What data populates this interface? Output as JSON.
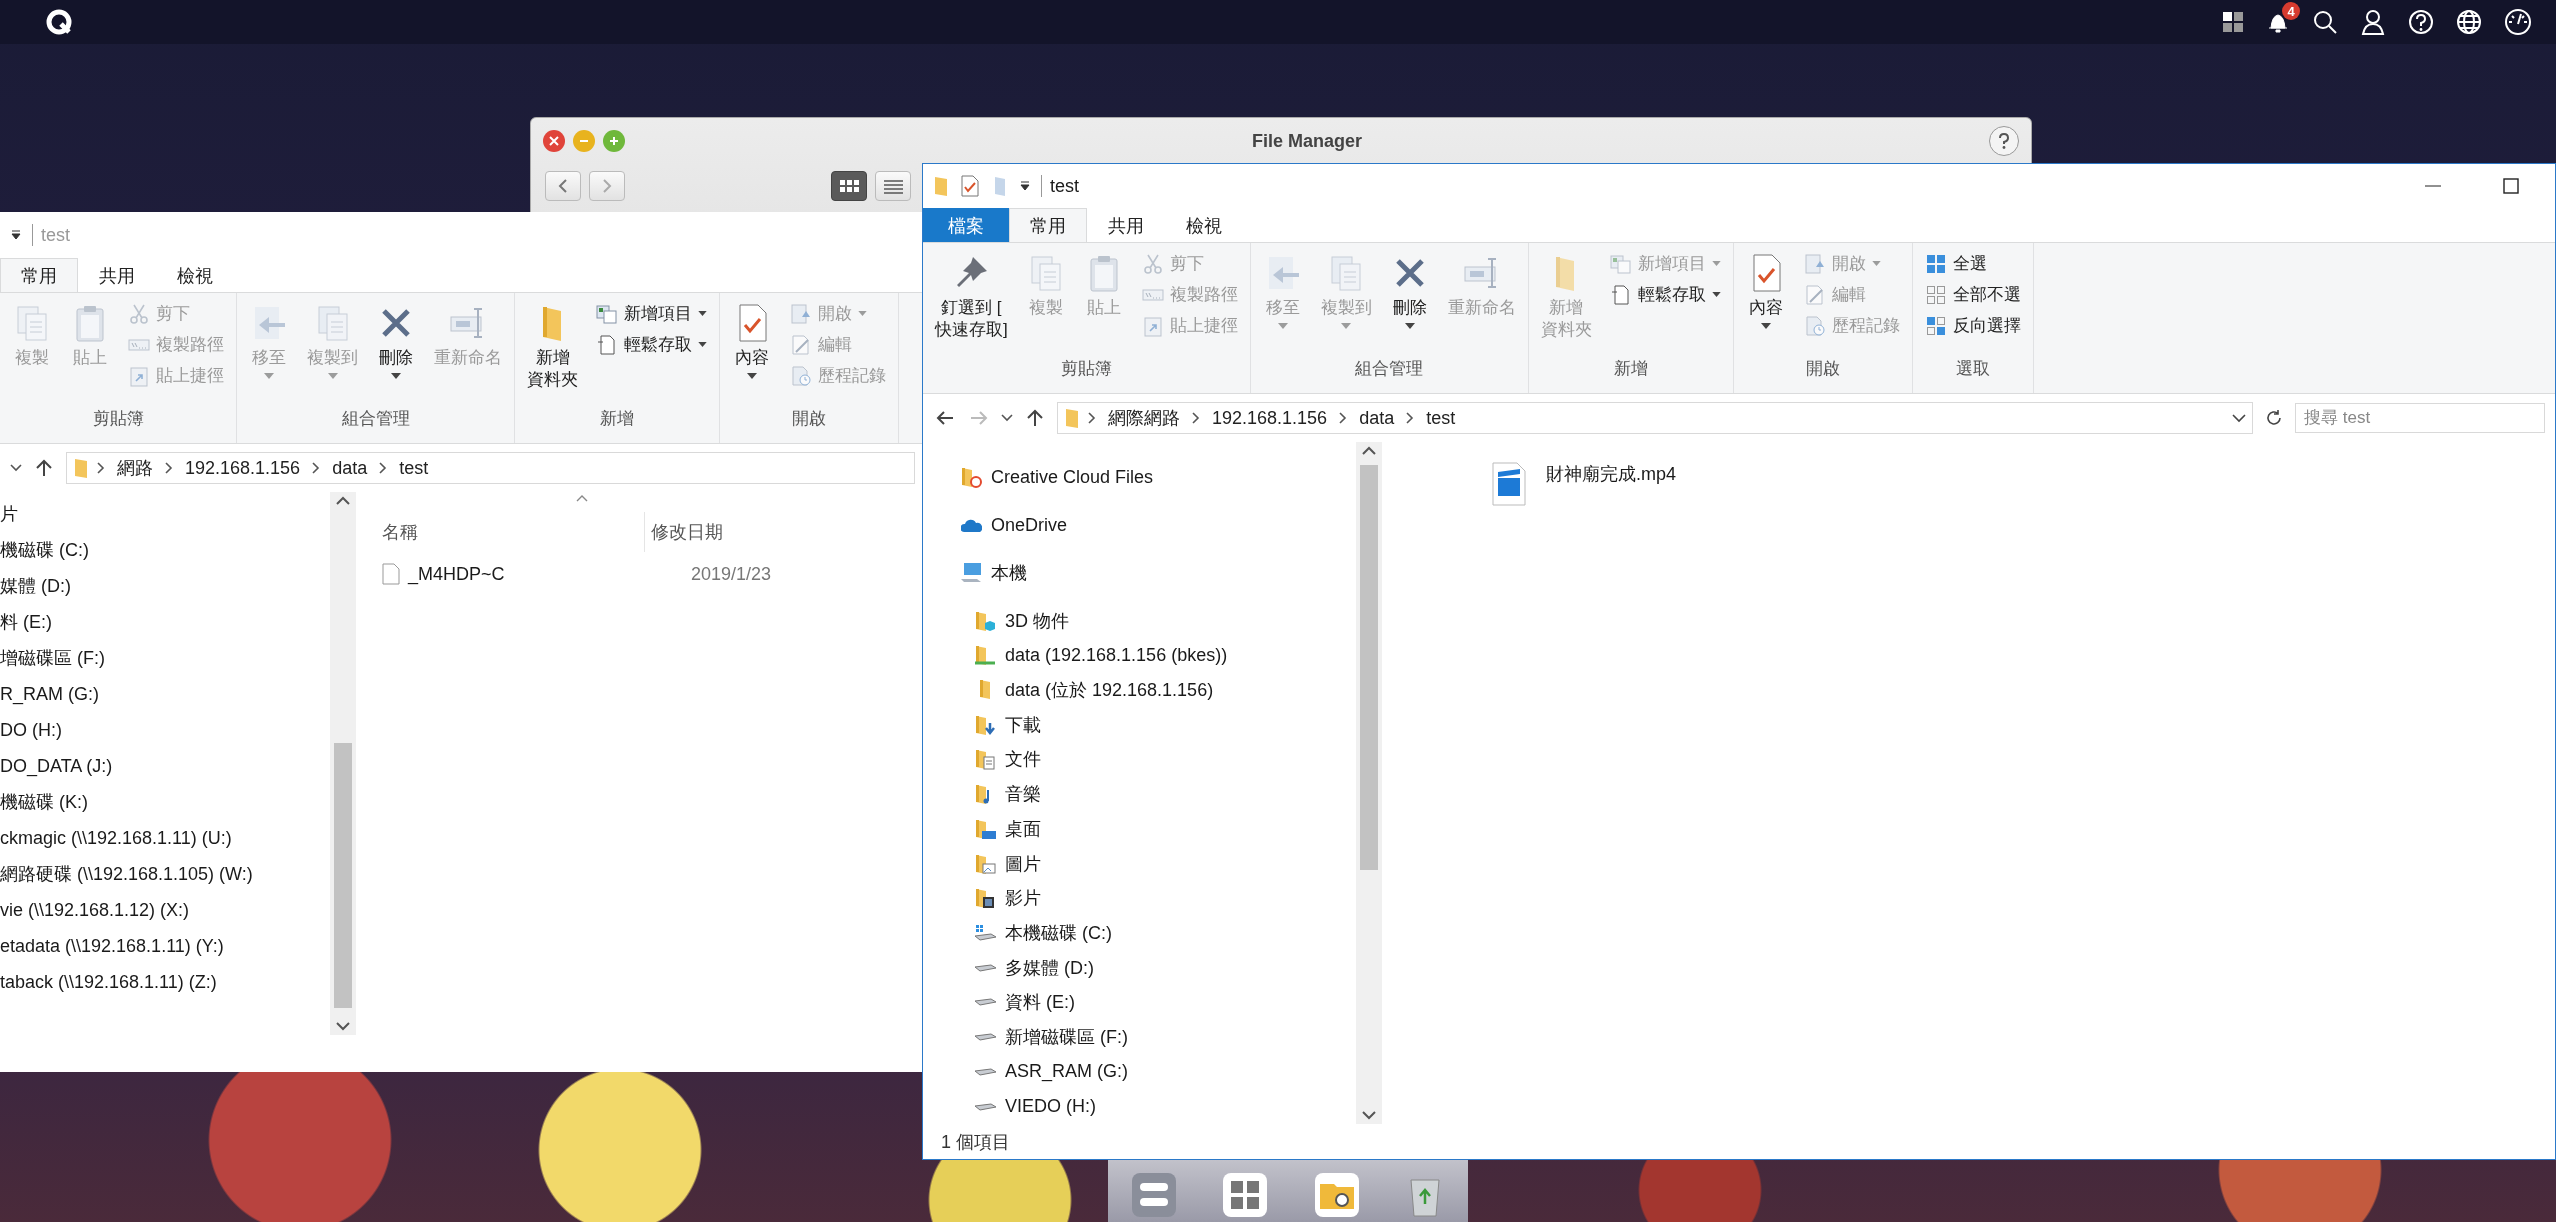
{
  "top_bar": {
    "notification_count": "4"
  },
  "file_manager": {
    "title": "File Manager",
    "views": [
      {
        "kind": "grid",
        "selected": true
      },
      {
        "kind": "list",
        "selected": false
      }
    ]
  },
  "left_explorer": {
    "title": "test",
    "tabs": [
      {
        "label": "常用",
        "kind": "tab",
        "selected": true
      },
      {
        "label": "共用",
        "kind": "tab",
        "selected": false
      },
      {
        "label": "檢視",
        "kind": "tab",
        "selected": false
      }
    ],
    "ribbon": [
      {
        "label": "剪貼簿",
        "items": [
          {
            "kind": "copy",
            "lines": [
              "複製"
            ],
            "disabled": true,
            "dropdown": false
          },
          {
            "kind": "paste",
            "lines": [
              "貼上"
            ],
            "disabled": true,
            "dropdown": false
          },
          {
            "kind": "stack",
            "commands": [
              {
                "kind": "cut",
                "label": "剪下",
                "disabled": true,
                "dropdown": false
              },
              {
                "kind": "copy-path",
                "label": "複製路徑",
                "disabled": true,
                "dropdown": false
              },
              {
                "kind": "paste-shortcut",
                "label": "貼上捷徑",
                "disabled": true,
                "dropdown": false
              }
            ]
          }
        ]
      },
      {
        "label": "組合管理",
        "items": [
          {
            "kind": "move",
            "lines": [
              "移至"
            ],
            "disabled": true,
            "dropdown": true
          },
          {
            "kind": "copy-to",
            "lines": [
              "複製到"
            ],
            "disabled": true,
            "dropdown": true
          },
          {
            "kind": "delete",
            "lines": [
              "刪除"
            ],
            "disabled": false,
            "dropdown": true
          },
          {
            "kind": "rename",
            "lines": [
              "重新命名"
            ],
            "disabled": true,
            "dropdown": false
          }
        ]
      },
      {
        "label": "新增",
        "items": [
          {
            "kind": "new-folder",
            "lines": [
              "新增",
              "資料夾"
            ],
            "disabled": false,
            "dropdown": false
          },
          {
            "kind": "stack",
            "commands": [
              {
                "kind": "new-item",
                "label": "新增項目",
                "disabled": false,
                "dropdown": true
              },
              {
                "kind": "easy-access",
                "label": "輕鬆存取",
                "disabled": false,
                "dropdown": true
              }
            ]
          }
        ]
      },
      {
        "label": "開啟",
        "items": [
          {
            "kind": "properties",
            "lines": [
              "內容"
            ],
            "disabled": false,
            "dropdown": true
          },
          {
            "kind": "stack",
            "commands": [
              {
                "kind": "open",
                "label": "開啟",
                "disabled": true,
                "dropdown": true
              },
              {
                "kind": "edit",
                "label": "編輯",
                "disabled": true,
                "dropdown": false
              },
              {
                "kind": "history",
                "label": "歷程記錄",
                "disabled": true,
                "dropdown": false
              }
            ]
          }
        ]
      }
    ],
    "breadcrumb": [
      "網路",
      "192.168.1.156",
      "data",
      "test"
    ],
    "nav": [
      {
        "label": "片"
      },
      {
        "label": "機磁碟 (C:)"
      },
      {
        "label": "媒體 (D:)"
      },
      {
        "label": "料 (E:)"
      },
      {
        "label": "增磁碟區 (F:)"
      },
      {
        "label": "R_RAM (G:)"
      },
      {
        "label": "DO (H:)"
      },
      {
        "label": "DO_DATA (J:)"
      },
      {
        "label": "機磁碟 (K:)"
      },
      {
        "label": "ckmagic (\\\\192.168.1.11) (U:)"
      },
      {
        "label": "網路硬碟 (\\\\192.168.1.105) (W:)"
      },
      {
        "label": "vie (\\\\192.168.1.12) (X:)"
      },
      {
        "label": "etadata (\\\\192.168.1.11) (Y:)"
      },
      {
        "label": "taback (\\\\192.168.1.11) (Z:)"
      }
    ],
    "columns": [
      "名稱",
      "修改日期"
    ],
    "files": [
      {
        "name": "_M4HDP~C",
        "modified": "2019/1/23"
      }
    ]
  },
  "right_explorer": {
    "title": "test",
    "tabs": [
      {
        "label": "檔案",
        "kind": "file-menu",
        "selected": false
      },
      {
        "label": "常用",
        "kind": "tab",
        "selected": true
      },
      {
        "label": "共用",
        "kind": "tab",
        "selected": false
      },
      {
        "label": "檢視",
        "kind": "tab",
        "selected": false
      }
    ],
    "ribbon": [
      {
        "label": "剪貼簿",
        "items": [
          {
            "kind": "pin",
            "lines": [
              "釘選到 [",
              "快速存取]"
            ],
            "disabled": false,
            "dropdown": false
          },
          {
            "kind": "copy",
            "lines": [
              "複製"
            ],
            "disabled": true,
            "dropdown": false
          },
          {
            "kind": "paste",
            "lines": [
              "貼上"
            ],
            "disabled": true,
            "dropdown": false
          },
          {
            "kind": "stack",
            "commands": [
              {
                "kind": "cut",
                "label": "剪下",
                "disabled": true,
                "dropdown": false
              },
              {
                "kind": "copy-path",
                "label": "複製路徑",
                "disabled": true,
                "dropdown": false
              },
              {
                "kind": "paste-shortcut",
                "label": "貼上捷徑",
                "disabled": true,
                "dropdown": false
              }
            ]
          }
        ]
      },
      {
        "label": "組合管理",
        "items": [
          {
            "kind": "move",
            "lines": [
              "移至"
            ],
            "disabled": true,
            "dropdown": true
          },
          {
            "kind": "copy-to",
            "lines": [
              "複製到"
            ],
            "disabled": true,
            "dropdown": true
          },
          {
            "kind": "delete",
            "lines": [
              "刪除"
            ],
            "disabled": false,
            "dropdown": true
          },
          {
            "kind": "rename",
            "lines": [
              "重新命名"
            ],
            "disabled": true,
            "dropdown": false
          }
        ]
      },
      {
        "label": "新增",
        "items": [
          {
            "kind": "new-folder",
            "lines": [
              "新增",
              "資料夾"
            ],
            "disabled": true,
            "dropdown": false
          },
          {
            "kind": "stack",
            "commands": [
              {
                "kind": "new-item",
                "label": "新增項目",
                "disabled": true,
                "dropdown": true
              },
              {
                "kind": "easy-access",
                "label": "輕鬆存取",
                "disabled": false,
                "dropdown": true
              }
            ]
          }
        ]
      },
      {
        "label": "開啟",
        "items": [
          {
            "kind": "properties",
            "lines": [
              "內容"
            ],
            "disabled": false,
            "dropdown": true
          },
          {
            "kind": "stack",
            "commands": [
              {
                "kind": "open",
                "label": "開啟",
                "disabled": true,
                "dropdown": true
              },
              {
                "kind": "edit",
                "label": "編輯",
                "disabled": true,
                "dropdown": false
              },
              {
                "kind": "history",
                "label": "歷程記錄",
                "disabled": true,
                "dropdown": false
              }
            ]
          }
        ]
      },
      {
        "label": "選取",
        "items": [
          {
            "kind": "stack",
            "commands": [
              {
                "kind": "select-all",
                "label": "全選",
                "disabled": false,
                "dropdown": false
              },
              {
                "kind": "select-none",
                "label": "全部不選",
                "disabled": false,
                "dropdown": false
              },
              {
                "kind": "invert",
                "label": "反向選擇",
                "disabled": false,
                "dropdown": false
              }
            ]
          }
        ]
      }
    ],
    "breadcrumb": [
      "網際網路",
      "192.168.1.156",
      "data",
      "test"
    ],
    "search": {
      "placeholder": "搜尋 test"
    },
    "nav": [
      {
        "label": "Creative Cloud Files",
        "kind": "cc-folder"
      },
      {
        "label": "OneDrive",
        "kind": "onedrive"
      },
      {
        "label": "本機",
        "kind": "computer",
        "children": [
          {
            "label": "3D 物件",
            "kind": "folder-3d"
          },
          {
            "label": "data (192.168.1.156 (bkes))",
            "kind": "net-folder"
          },
          {
            "label": "data (位於 192.168.1.156)",
            "kind": "folder"
          },
          {
            "label": "下載",
            "kind": "downloads"
          },
          {
            "label": "文件",
            "kind": "documents"
          },
          {
            "label": "音樂",
            "kind": "music"
          },
          {
            "label": "桌面",
            "kind": "desktop"
          },
          {
            "label": "圖片",
            "kind": "pictures"
          },
          {
            "label": "影片",
            "kind": "videos"
          },
          {
            "label": "本機磁碟 (C:)",
            "kind": "system-drive"
          },
          {
            "label": "多媒體 (D:)",
            "kind": "drive"
          },
          {
            "label": "資料 (E:)",
            "kind": "drive"
          },
          {
            "label": "新增磁碟區 (F:)",
            "kind": "drive"
          },
          {
            "label": "ASR_RAM (G:)",
            "kind": "drive"
          },
          {
            "label": "VIEDO (H:)",
            "kind": "drive"
          }
        ]
      }
    ],
    "files": [
      {
        "name": "財神廟完成.mp4"
      }
    ],
    "status": "1 個項目"
  }
}
